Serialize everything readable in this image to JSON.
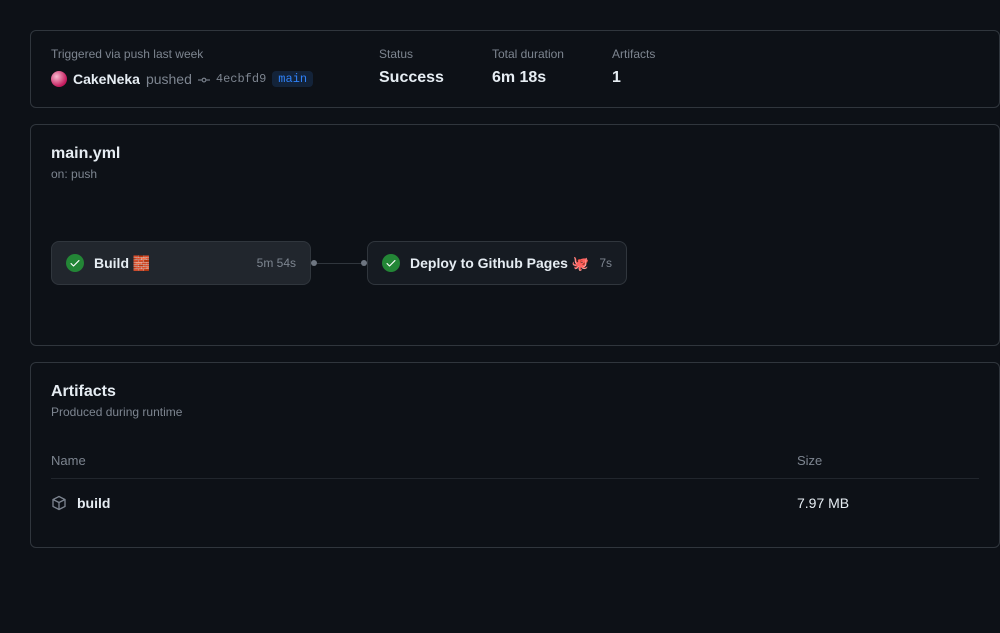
{
  "summary": {
    "trigger_label": "Triggered via push last week",
    "actor": "CakeNeka",
    "action": "pushed",
    "sha": "4ecbfd9",
    "branch": "main",
    "status_label": "Status",
    "status_value": "Success",
    "duration_label": "Total duration",
    "duration_value": "6m 18s",
    "artifacts_label": "Artifacts",
    "artifacts_value": "1"
  },
  "workflow": {
    "title": "main.yml",
    "subtitle": "on: push",
    "jobs": [
      {
        "name": "Build 🧱",
        "duration": "5m 54s"
      },
      {
        "name": "Deploy to Github Pages 🐙",
        "duration": "7s"
      }
    ]
  },
  "artifacts": {
    "title": "Artifacts",
    "subtitle": "Produced during runtime",
    "columns": {
      "name": "Name",
      "size": "Size"
    },
    "rows": [
      {
        "name": "build",
        "size": "7.97 MB"
      }
    ]
  }
}
